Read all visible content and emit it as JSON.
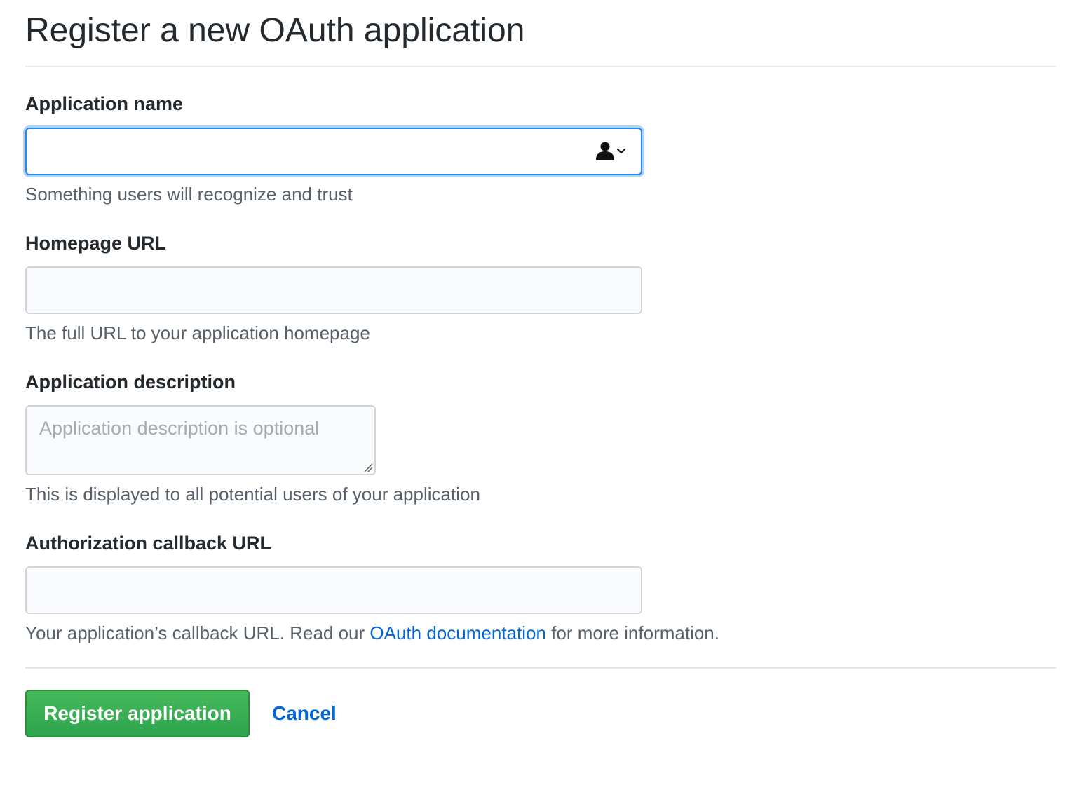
{
  "title": "Register a new OAuth application",
  "fields": {
    "app_name": {
      "label": "Application name",
      "value": "",
      "note": "Something users will recognize and trust"
    },
    "homepage_url": {
      "label": "Homepage URL",
      "value": "",
      "note": "The full URL to your application homepage"
    },
    "description": {
      "label": "Application description",
      "placeholder": "Application description is optional",
      "note": "This is displayed to all potential users of your application"
    },
    "callback_url": {
      "label": "Authorization callback URL",
      "value": "",
      "note_prefix": "Your application’s callback URL. Read our ",
      "note_link": "OAuth documentation",
      "note_suffix": " for more information."
    }
  },
  "actions": {
    "submit_label": "Register application",
    "cancel_label": "Cancel"
  },
  "icons": {
    "autofill": "person-contact-autofill-icon"
  },
  "colors": {
    "primary_button": "#2ea44f",
    "link": "#0366d6",
    "focus_border": "#2188ff"
  }
}
